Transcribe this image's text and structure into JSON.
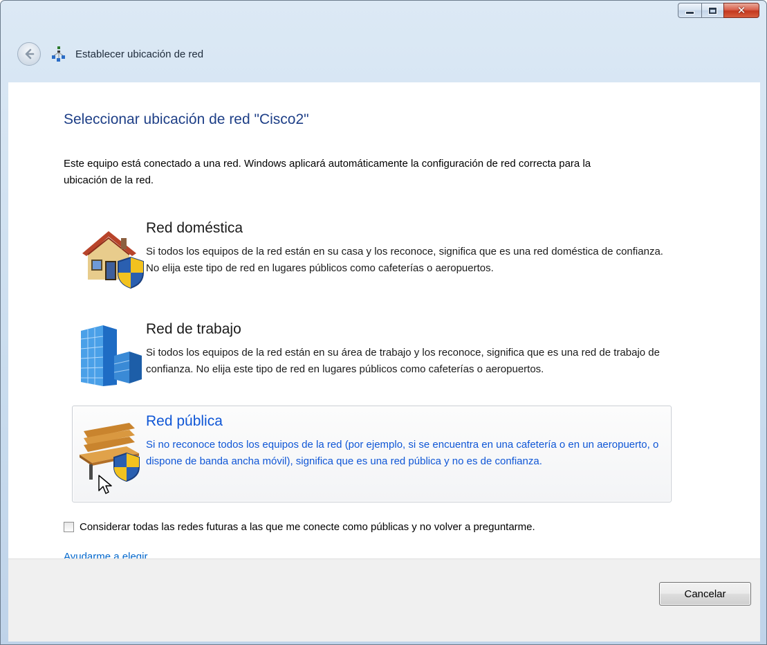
{
  "window": {
    "title": "Establecer ubicación de red",
    "controls": {
      "minimize_icon": "minimize-icon",
      "maximize_icon": "maximize-icon",
      "close_glyph": "✕"
    }
  },
  "main": {
    "heading": "Seleccionar ubicación de red \"Cisco2\"",
    "intro": "Este equipo está conectado a una red. Windows aplicará automáticamente la configuración de red correcta para la ubicación de la red.",
    "options": [
      {
        "title": "Red doméstica",
        "description": "Si todos los equipos de la red están en su casa y los reconoce, significa que es una red doméstica de confianza. No elija este tipo de red en lugares públicos como cafeterías o aeropuertos.",
        "icon": "home-network-icon"
      },
      {
        "title": "Red de trabajo",
        "description": "Si todos los equipos de la red están en su área de trabajo y los reconoce, significa que es una red de trabajo de confianza. No elija este tipo de red en lugares públicos como cafeterías o aeropuertos.",
        "icon": "work-network-icon"
      },
      {
        "title": "Red pública",
        "description": "Si no reconoce todos los equipos de la red (por ejemplo, si se encuentra en una cafetería o en un aeropuerto, o dispone de banda ancha móvil), significa que es una red pública y no es de confianza.",
        "icon": "public-network-icon",
        "hovered": true
      }
    ],
    "checkbox": {
      "label": "Considerar todas las redes futuras a las que me conecte como públicas y no volver a preguntarme.",
      "checked": false
    },
    "help_link": "Ayudarme a elegir"
  },
  "footer": {
    "cancel_label": "Cancelar"
  },
  "colors": {
    "heading": "#1e3f87",
    "link": "#0066cc",
    "hover_text": "#0f56d6"
  }
}
